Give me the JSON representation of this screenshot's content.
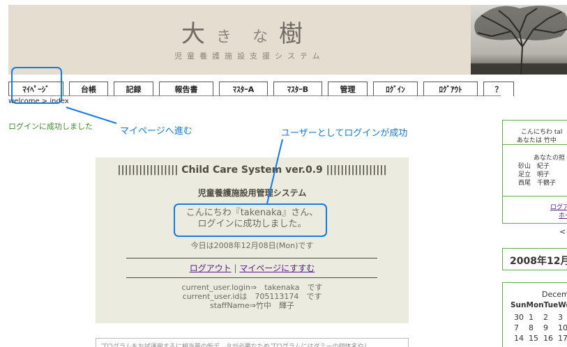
{
  "header": {
    "title_chars": [
      "大",
      "き",
      "な",
      "樹"
    ],
    "subtitle": "児童養護施設支援システム"
  },
  "nav": {
    "items": [
      {
        "label": "ﾏｲﾍﾟｰｼﾞ"
      },
      {
        "label": "台帳"
      },
      {
        "label": "記録"
      },
      {
        "label": "報告書"
      },
      {
        "label": "ﾏｽﾀｰA"
      },
      {
        "label": "ﾏｽﾀｰB"
      },
      {
        "label": "管理"
      },
      {
        "label": "ﾛｸﾞｲﾝ"
      },
      {
        "label": "ﾛｸﾞｱｳﾄ"
      },
      {
        "label": "？"
      }
    ]
  },
  "breadcrumb": "welcome > index",
  "login_message": "ログインに成功しました",
  "annotations": {
    "mypage": "マイページへ進む",
    "login_success": "ユーザーとしてログインが成功"
  },
  "main": {
    "title": "||||||||||||||||| Child Care System ver.0.9 |||||||||||||||||",
    "subtitle": "児童養護施設用管理システム",
    "greeting_line1": "こんにちわ『takenaka』さん、",
    "greeting_line2": "ログインに成功しました。",
    "date_line": "今日は2008年12月08日(Mon)です",
    "logout_link": "ログアウト",
    "link_separator": "|",
    "mypage_link": "マイページにすすむ",
    "info_login": "current_user.login⇒　takenaka　です",
    "info_id": "current_user.idは　705113174　です",
    "info_staff": "staffName⇒竹中　輝子"
  },
  "bottom_text": "プログラムをお試運用するに相当量の仮デ　タが必要なためプログラムにはダミーの個体名やし",
  "sidebar": {
    "greeting": "こんにちわ tal",
    "you_are": "あなたは 竹中",
    "assigned_label": "あなたの担",
    "children": [
      "砂山　紀子",
      "足立　明子",
      "西尾　千鶴子"
    ],
    "link1": "ログア",
    "link2": "ホー",
    "arrow": "<",
    "date_heading": "2008年12月",
    "calendar": {
      "month": "Decem",
      "weekdays": "SunMonTueWe",
      "rows": [
        [
          "30",
          "1",
          "2",
          "3"
        ],
        [
          "7",
          "8",
          "9",
          "10"
        ],
        [
          "14",
          "15",
          "16",
          "17"
        ]
      ]
    }
  }
}
